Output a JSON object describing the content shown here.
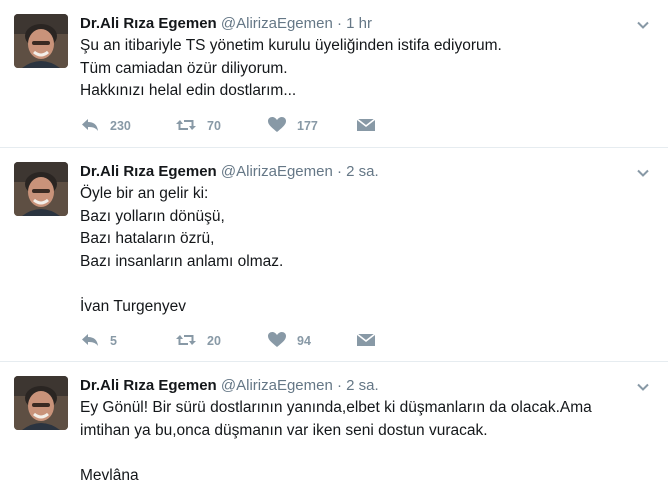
{
  "tweets": [
    {
      "name": "Dr.Ali Rıza Egemen",
      "handle": "@AlirizaEgemen",
      "separator": "·",
      "time": "1 hr",
      "lines": [
        "Şu an itibariyle TS yönetim kurulu üyeliğinden istifa ediyorum.",
        "Tüm camiadan özür diliyorum.",
        "Hakkınızı helal edin dostlarım..."
      ],
      "replies": "230",
      "retweets": "70",
      "likes": "177"
    },
    {
      "name": "Dr.Ali Rıza Egemen",
      "handle": "@AlirizaEgemen",
      "separator": "·",
      "time": "2 sa.",
      "lines": [
        "Öyle bir an gelir ki:",
        "Bazı yolların dönüşü,",
        "Bazı hataların özrü,",
        "Bazı insanların anlamı olmaz.",
        "",
        "İvan Turgenyev"
      ],
      "replies": "5",
      "retweets": "20",
      "likes": "94"
    },
    {
      "name": "Dr.Ali Rıza Egemen",
      "handle": "@AlirizaEgemen",
      "separator": "·",
      "time": "2 sa.",
      "lines": [
        "Ey Gönül! Bir sürü dostlarının yanında,elbet ki düşmanların da olacak.Ama",
        "imtihan ya bu,onca düşmanın var iken seni dostun vuracak.",
        "",
        "Mevlâna"
      ]
    }
  ],
  "icons": {
    "reply": "reply-icon",
    "retweet": "retweet-icon",
    "like": "heart-icon",
    "dm": "envelope-icon",
    "caret": "chevron-down-icon"
  },
  "colors": {
    "name": "#14171a",
    "meta": "#657786",
    "action": "#8899a6",
    "divider": "#e6ecf0"
  }
}
